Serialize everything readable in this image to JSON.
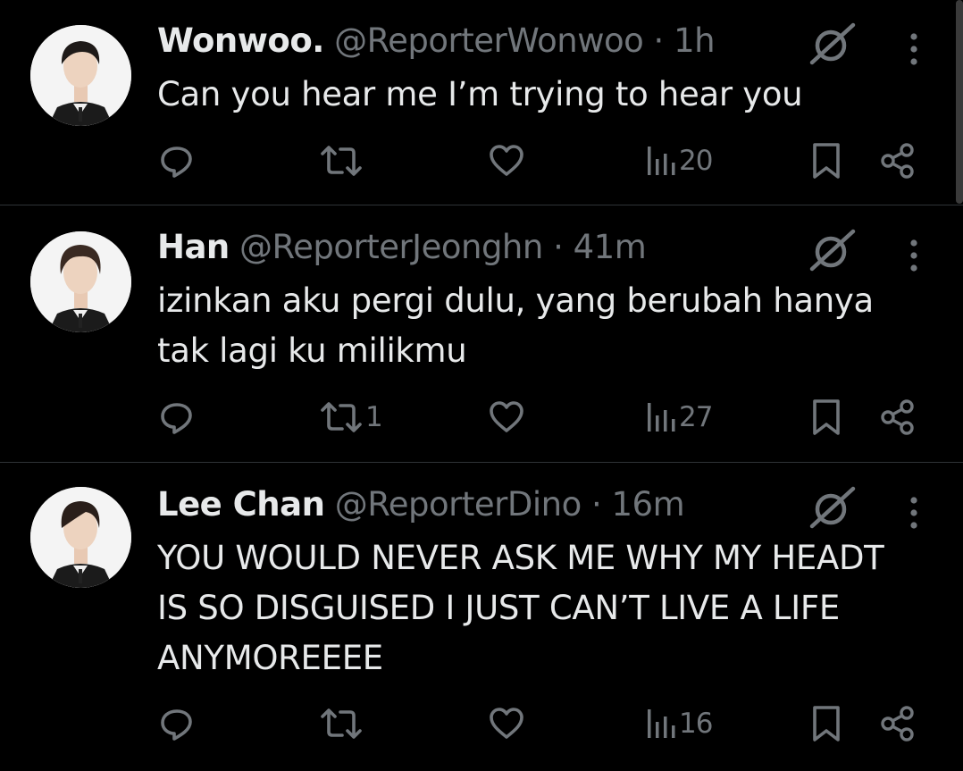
{
  "tweets": [
    {
      "name": "Wonwoo.",
      "handle": "@ReporterWonwoo",
      "separator": "·",
      "time": "1h",
      "text": "Can you hear me I’m trying to hear you",
      "reposts": "",
      "views": "20"
    },
    {
      "name": "Han",
      "handle": "@ReporterJeonghn",
      "separator": "·",
      "time": "41m",
      "text": "izinkan aku pergi dulu, yang berubah hanya tak lagi ku milikmu",
      "reposts": "1",
      "views": "27"
    },
    {
      "name": "Lee Chan",
      "handle": "@ReporterDino",
      "separator": "·",
      "time": "16m",
      "text": "YOU WOULD NEVER ASK ME WHY MY HEADT IS SO DISGUISED I JUST CAN’T LIVE A LIFE ANYMOREEEE",
      "reposts": "",
      "views": "16"
    }
  ],
  "icons": {
    "reply": "reply-icon",
    "repost": "repost-icon",
    "like": "heart-icon",
    "views": "views-icon",
    "bookmark": "bookmark-icon",
    "share": "share-icon",
    "grok": "grok-icon",
    "more": "more-dots-icon"
  },
  "colors": {
    "background": "#000000",
    "text": "#e7e9ea",
    "secondary": "#71767b",
    "divider": "#2f3336"
  }
}
